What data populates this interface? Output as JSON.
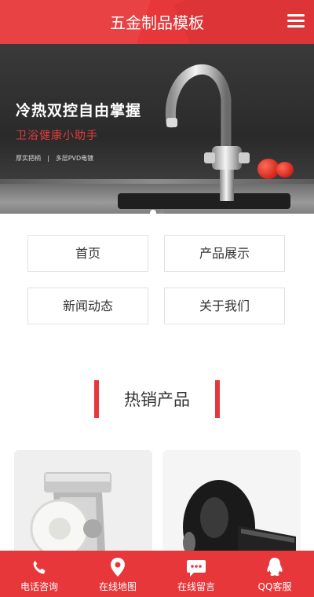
{
  "header": {
    "title": "五金制品模板"
  },
  "banner": {
    "headline": "冷热双控自由掌握",
    "subline": "卫浴健康小助手",
    "feature_1": "厚实把柄",
    "feature_sep": "|",
    "feature_2": "多层PVD电镀",
    "slide_count": 2,
    "active_slide": 1
  },
  "nav": {
    "items": [
      {
        "label": "首页"
      },
      {
        "label": "产品展示"
      },
      {
        "label": "新闻动态"
      },
      {
        "label": "关于我们"
      }
    ]
  },
  "hot": {
    "title": "热销产品"
  },
  "footer": {
    "items": [
      {
        "label": "电话咨询",
        "icon": "phone-icon"
      },
      {
        "label": "在线地图",
        "icon": "map-pin-icon"
      },
      {
        "label": "在线留言",
        "icon": "message-icon"
      },
      {
        "label": "QQ客服",
        "icon": "qq-icon"
      }
    ]
  },
  "colors": {
    "accent": "#e8373a"
  }
}
